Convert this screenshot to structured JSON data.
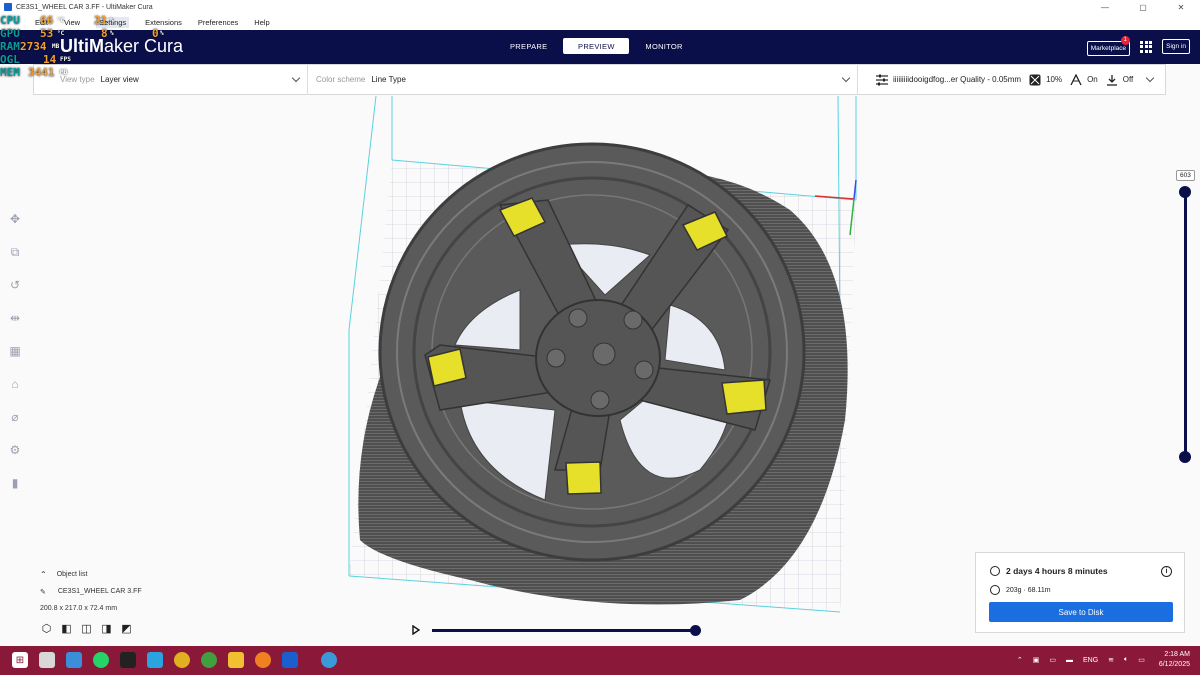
{
  "window": {
    "title": "CE3S1_WHEEL CAR 3.FF - UltiMaker Cura",
    "minimize": "—",
    "maximize": "▢",
    "close": "✕"
  },
  "menubar": {
    "items": [
      "Edit",
      "View",
      "Settings",
      "Extensions",
      "Preferences",
      "Help"
    ]
  },
  "header": {
    "brand_bold": "UltiM",
    "brand_rest": "aker Cura",
    "stages": [
      "PREPARE",
      "PREVIEW",
      "MONITOR"
    ],
    "active_stage": "PREVIEW",
    "marketplace": "Marketplace",
    "marketplace_badge": "1",
    "signin": "Sign in"
  },
  "overlay_stats": [
    {
      "label": "CPU",
      "v1": "66",
      "u1": "°C",
      "v2": "21",
      "u2": "%"
    },
    {
      "label": "GPU",
      "v1": "53",
      "u1": "°C",
      "v2": "8",
      "u2": "%",
      "v3": "0",
      "u3": "%"
    },
    {
      "label": "RAM",
      "v1": "2734",
      "u1": "MB"
    },
    {
      "label": "OGL",
      "v1": "14",
      "u1": "FPS"
    },
    {
      "label": "MEM",
      "v1": "3441",
      "u1": "MB"
    }
  ],
  "viewbar": {
    "view_type_label": "View type",
    "view_type_value": "Layer view",
    "color_scheme_label": "Color scheme",
    "color_scheme_value": "Line Type",
    "profile": "iiiiiiiiidooigdfog...er Quality - 0.05mm",
    "infill": "10%",
    "support": "On",
    "adhesion": "Off"
  },
  "layer": {
    "current": "603",
    "fraction": 1.0
  },
  "object_list": {
    "toggle_label": "Object list",
    "object_name": "CE3S1_WHEEL CAR 3.FF",
    "dimensions": "200.8 x 217.0 x 72.4 mm"
  },
  "playback": {
    "progress": 1.0
  },
  "print_panel": {
    "time": "2 days 4 hours 8 minutes",
    "material": "203g · 68.11m",
    "save_label": "Save to Disk"
  },
  "taskbar": {
    "language": "ENG",
    "time": "2:18 AM",
    "date": "6/12/2025"
  },
  "colors": {
    "header": "#0a0f4a",
    "accent": "#1b6ee0",
    "taskbar": "#8a1838",
    "support": "#e6e02a",
    "model": "#5a5a5a"
  }
}
